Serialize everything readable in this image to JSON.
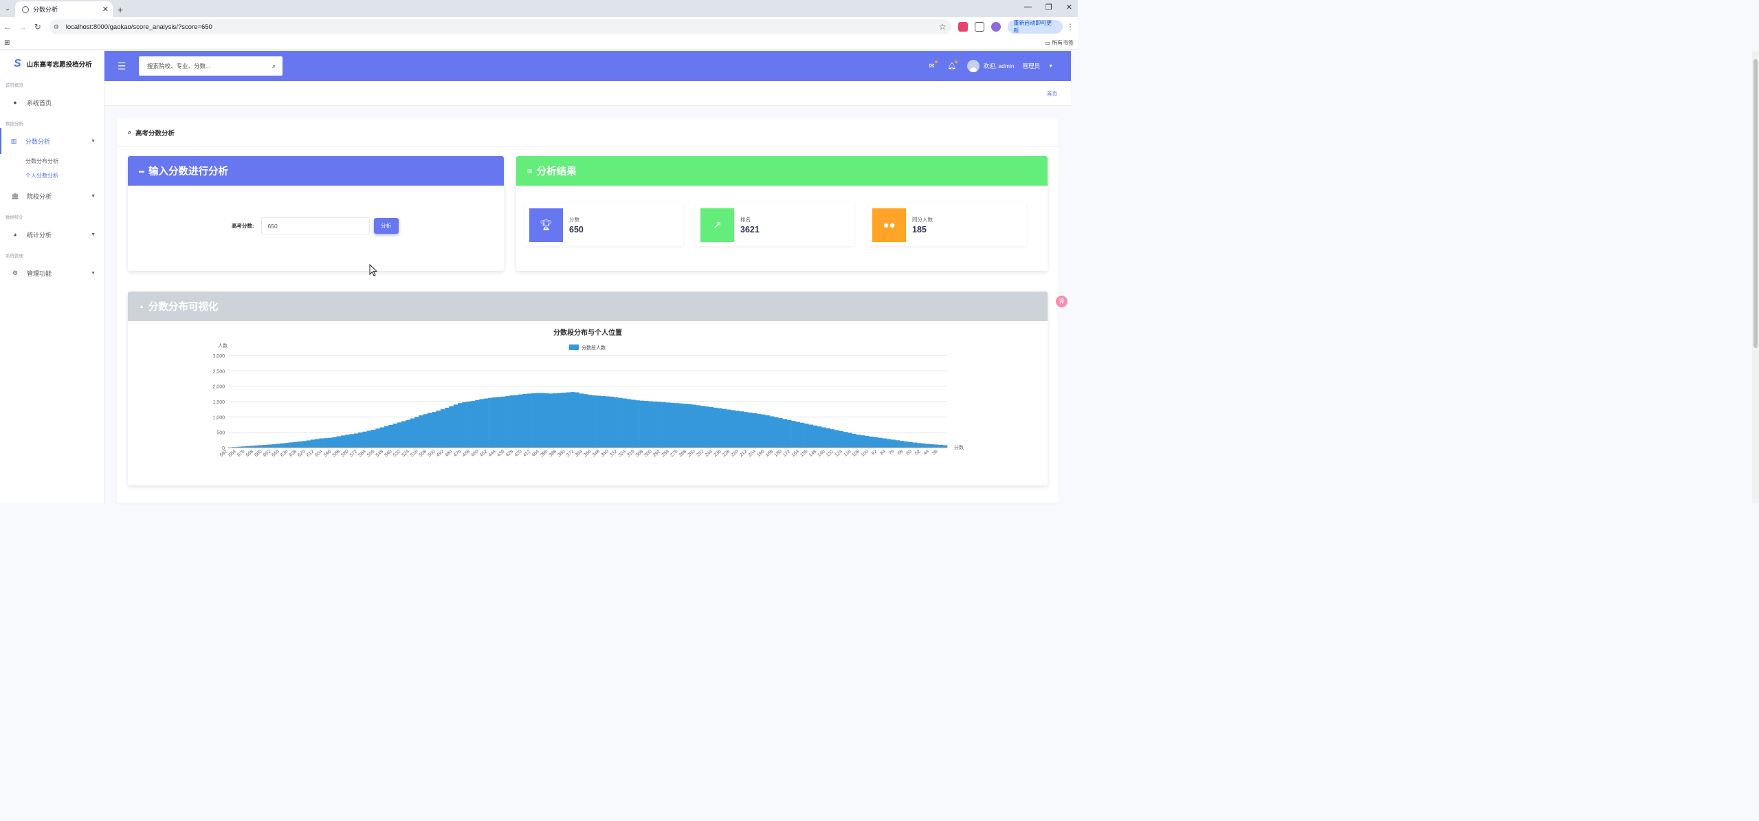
{
  "browser": {
    "tab_title": "分数分析",
    "url": "localhost:8000/gaokao/score_analysis/?score=650",
    "update_button": "重新启动即可更新",
    "bookmarks_folder": "所有书签"
  },
  "sidebar": {
    "brand_logo": "S",
    "brand": "山东高考志愿投档分析",
    "sections": {
      "home": "首页概览",
      "data": "数据分析",
      "stats": "数据统计",
      "admin": "系统管理"
    },
    "items": {
      "home": "系统首页",
      "score_analysis": "分数分析",
      "score_distribution": "分数分布分析",
      "personal_score": "个人分数分析",
      "school_analysis": "院校分析",
      "statistics": "统计分析",
      "management": "管理功能"
    }
  },
  "topbar": {
    "search_placeholder": "搜索院校、专业、分数...",
    "welcome": "欢迎, admin",
    "role": "管理员"
  },
  "breadcrumb": {
    "home": "首页"
  },
  "main": {
    "title": "高考分数分析",
    "input_panel": {
      "title": "输入分数进行分析",
      "label": "高考分数:",
      "value": "650",
      "button": "分析"
    },
    "result_panel": {
      "title": "分析结果",
      "stats": [
        {
          "label": "分数",
          "value": "650",
          "color": "#6777ef",
          "icon": "trophy-icon"
        },
        {
          "label": "排名",
          "value": "3621",
          "color": "#63ed7a",
          "icon": "chart-line-icon"
        },
        {
          "label": "同分人数",
          "value": "185",
          "color": "#ffa426",
          "icon": "users-icon"
        }
      ]
    },
    "viz_panel": {
      "title": "分数分布可视化"
    }
  },
  "colors": {
    "primary": "#6777ef",
    "success": "#63ed7a",
    "warning": "#ffa426",
    "muted": "#cdd3d8",
    "bar": "#3498db"
  },
  "chart_data": {
    "type": "bar",
    "title": "分数段分布与个人位置",
    "legend": "分数段人数",
    "xlabel": "分数",
    "ylabel": "人数",
    "ylim": [
      0,
      3000
    ],
    "yticks": [
      "0",
      "500",
      "1,000",
      "1,500",
      "2,000",
      "2,500",
      "3,000"
    ],
    "x_start": 692,
    "x_end": 152,
    "x_step": 4,
    "x_label_step": 8,
    "values": [
      10,
      20,
      30,
      40,
      50,
      60,
      70,
      80,
      90,
      100,
      110,
      125,
      140,
      155,
      170,
      185,
      200,
      215,
      235,
      260,
      280,
      300,
      310,
      320,
      340,
      370,
      395,
      420,
      440,
      460,
      490,
      520,
      550,
      580,
      620,
      660,
      700,
      740,
      780,
      820,
      860,
      900,
      950,
      1000,
      1050,
      1090,
      1130,
      1160,
      1200,
      1250,
      1300,
      1350,
      1400,
      1450,
      1480,
      1500,
      1520,
      1550,
      1580,
      1600,
      1620,
      1640,
      1650,
      1660,
      1680,
      1700,
      1710,
      1730,
      1750,
      1760,
      1770,
      1780,
      1780,
      1770,
      1760,
      1770,
      1780,
      1790,
      1800,
      1810,
      1800,
      1760,
      1740,
      1720,
      1700,
      1690,
      1680,
      1670,
      1660,
      1640,
      1620,
      1600,
      1580,
      1560,
      1540,
      1530,
      1520,
      1510,
      1500,
      1490,
      1480,
      1470,
      1460,
      1450,
      1440,
      1430,
      1420,
      1400,
      1380,
      1360,
      1340,
      1320,
      1300,
      1280,
      1260,
      1240,
      1220,
      1200,
      1180,
      1160,
      1140,
      1120,
      1100,
      1080,
      1050,
      1020,
      990,
      960,
      930,
      900,
      870,
      840,
      810,
      780,
      750,
      720,
      690,
      660,
      630,
      600,
      570,
      540,
      510,
      480,
      450,
      420,
      400,
      380,
      360,
      340,
      320,
      300,
      280,
      260,
      240,
      220,
      200,
      180,
      165,
      150,
      135,
      120,
      110,
      100,
      90,
      80
    ]
  }
}
